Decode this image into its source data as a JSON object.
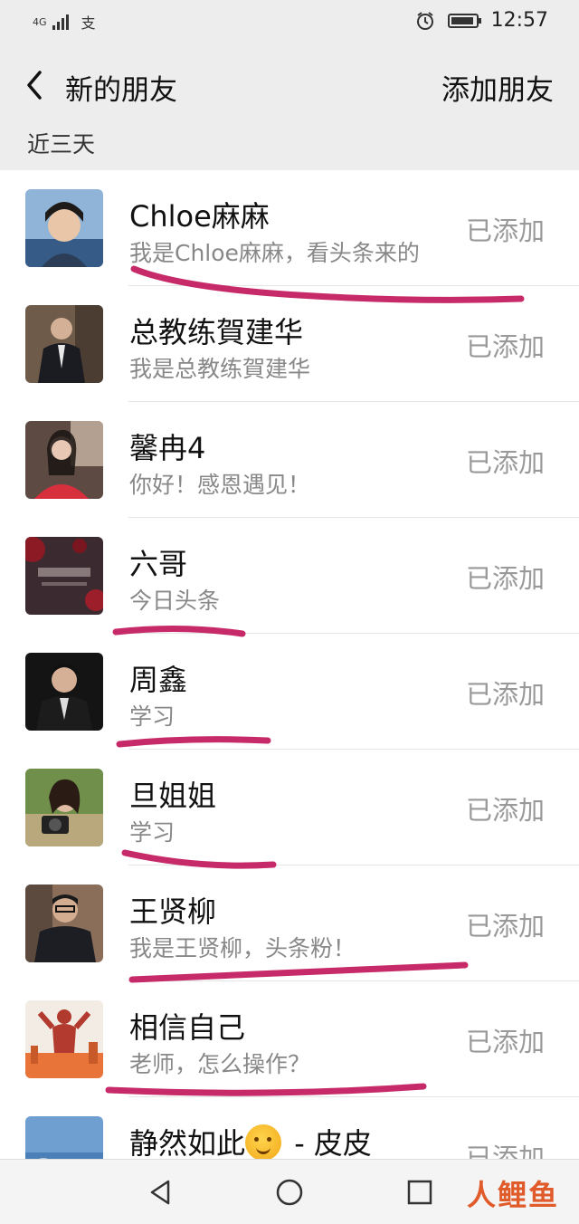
{
  "status_bar": {
    "network": "4G",
    "carrier_icon": "支",
    "time": "12:57"
  },
  "nav": {
    "title": "新的朋友",
    "action": "添加朋友"
  },
  "section_title": "近三天",
  "rows": [
    {
      "name": "Chloe麻麻",
      "message": "我是Chloe麻麻，看头条来的",
      "status": "已添加"
    },
    {
      "name": "总教练賀建华",
      "message": "我是总教练賀建华",
      "status": "已添加"
    },
    {
      "name": "馨冉4",
      "message": "你好！感恩遇见！",
      "status": "已添加"
    },
    {
      "name": "六哥",
      "message": "今日头条",
      "status": "已添加"
    },
    {
      "name": "周鑫",
      "message": "学习",
      "status": "已添加"
    },
    {
      "name": "旦姐姐",
      "message": "学习",
      "status": "已添加"
    },
    {
      "name": "王贤柳",
      "message": "我是王贤柳，头条粉！",
      "status": "已添加"
    },
    {
      "name": "相信自己",
      "message": "老师，怎么操作？",
      "status": "已添加"
    },
    {
      "name_prefix": "静然如此",
      "name_suffix": " - 皮皮",
      "emoji": "hugging-face-icon",
      "message": "",
      "status": "已添加"
    }
  ],
  "watermark": "人鲤鱼",
  "colors": {
    "highlight": "#c2185b"
  }
}
